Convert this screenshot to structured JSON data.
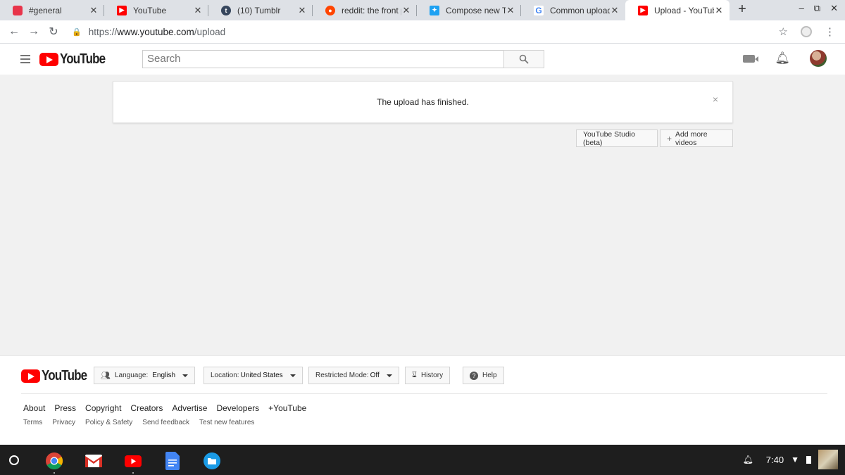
{
  "browser": {
    "tabs": [
      {
        "title": "#general",
        "icon": "slack-icon",
        "color": "#e8344a"
      },
      {
        "title": "YouTube",
        "icon": "youtube-icon",
        "color": "#ff0000"
      },
      {
        "title": "(10) Tumblr",
        "icon": "tumblr-icon",
        "color": "#36465d"
      },
      {
        "title": "reddit: the front pag",
        "icon": "reddit-icon",
        "color": "#ff4500"
      },
      {
        "title": "Compose new Twe",
        "icon": "twitter-icon",
        "color": "#1da1f2"
      },
      {
        "title": "Common uploadin",
        "icon": "google-icon",
        "color": "#4285f4"
      },
      {
        "title": "Upload - YouTube",
        "icon": "youtube-icon",
        "color": "#ff0000",
        "active": true
      }
    ],
    "new_tab": "+",
    "url_scheme": "https://",
    "url_host": "www.youtube.com",
    "url_path": "/upload"
  },
  "youtube": {
    "logo_text": "YouTube",
    "search_placeholder": "Search",
    "notice": "The upload has finished.",
    "notice_close": "×",
    "studio_button": "YouTube Studio (beta)",
    "add_more_button": "Add more videos",
    "add_more_prefix": "+"
  },
  "footer": {
    "logo_text": "YouTube",
    "language_label": "Language:",
    "language_value": "English",
    "location_label": "Location:",
    "location_value": "United States",
    "restricted_label": "Restricted Mode:",
    "restricted_value": "Off",
    "history": "History",
    "help": "Help",
    "links": [
      "About",
      "Press",
      "Copyright",
      "Creators",
      "Advertise",
      "Developers",
      "+YouTube"
    ],
    "links_small": [
      "Terms",
      "Privacy",
      "Policy & Safety",
      "Send feedback",
      "Test new features"
    ]
  },
  "shelf": {
    "apps": [
      "chrome-icon",
      "gmail-icon",
      "youtube-icon",
      "docs-icon",
      "files-icon"
    ],
    "time": "7:40"
  }
}
